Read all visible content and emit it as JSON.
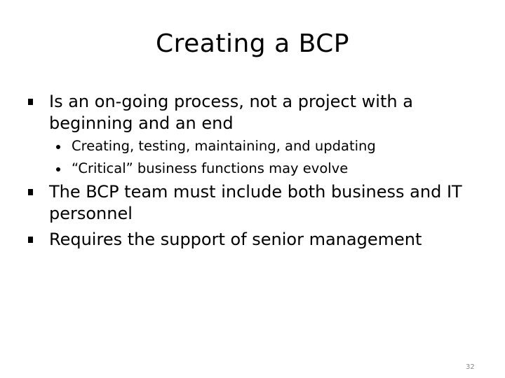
{
  "slide": {
    "title": "Creating a BCP",
    "bullets": [
      {
        "text": " Is an on-going process, not a project with a beginning and an end",
        "sub": [
          "Creating, testing, maintaining, and updating",
          "“Critical” business functions may evolve"
        ]
      },
      {
        "text": " The BCP team must include both business and IT personnel"
      },
      {
        "text": "Requires the support of senior management"
      }
    ],
    "page_number": "32"
  }
}
